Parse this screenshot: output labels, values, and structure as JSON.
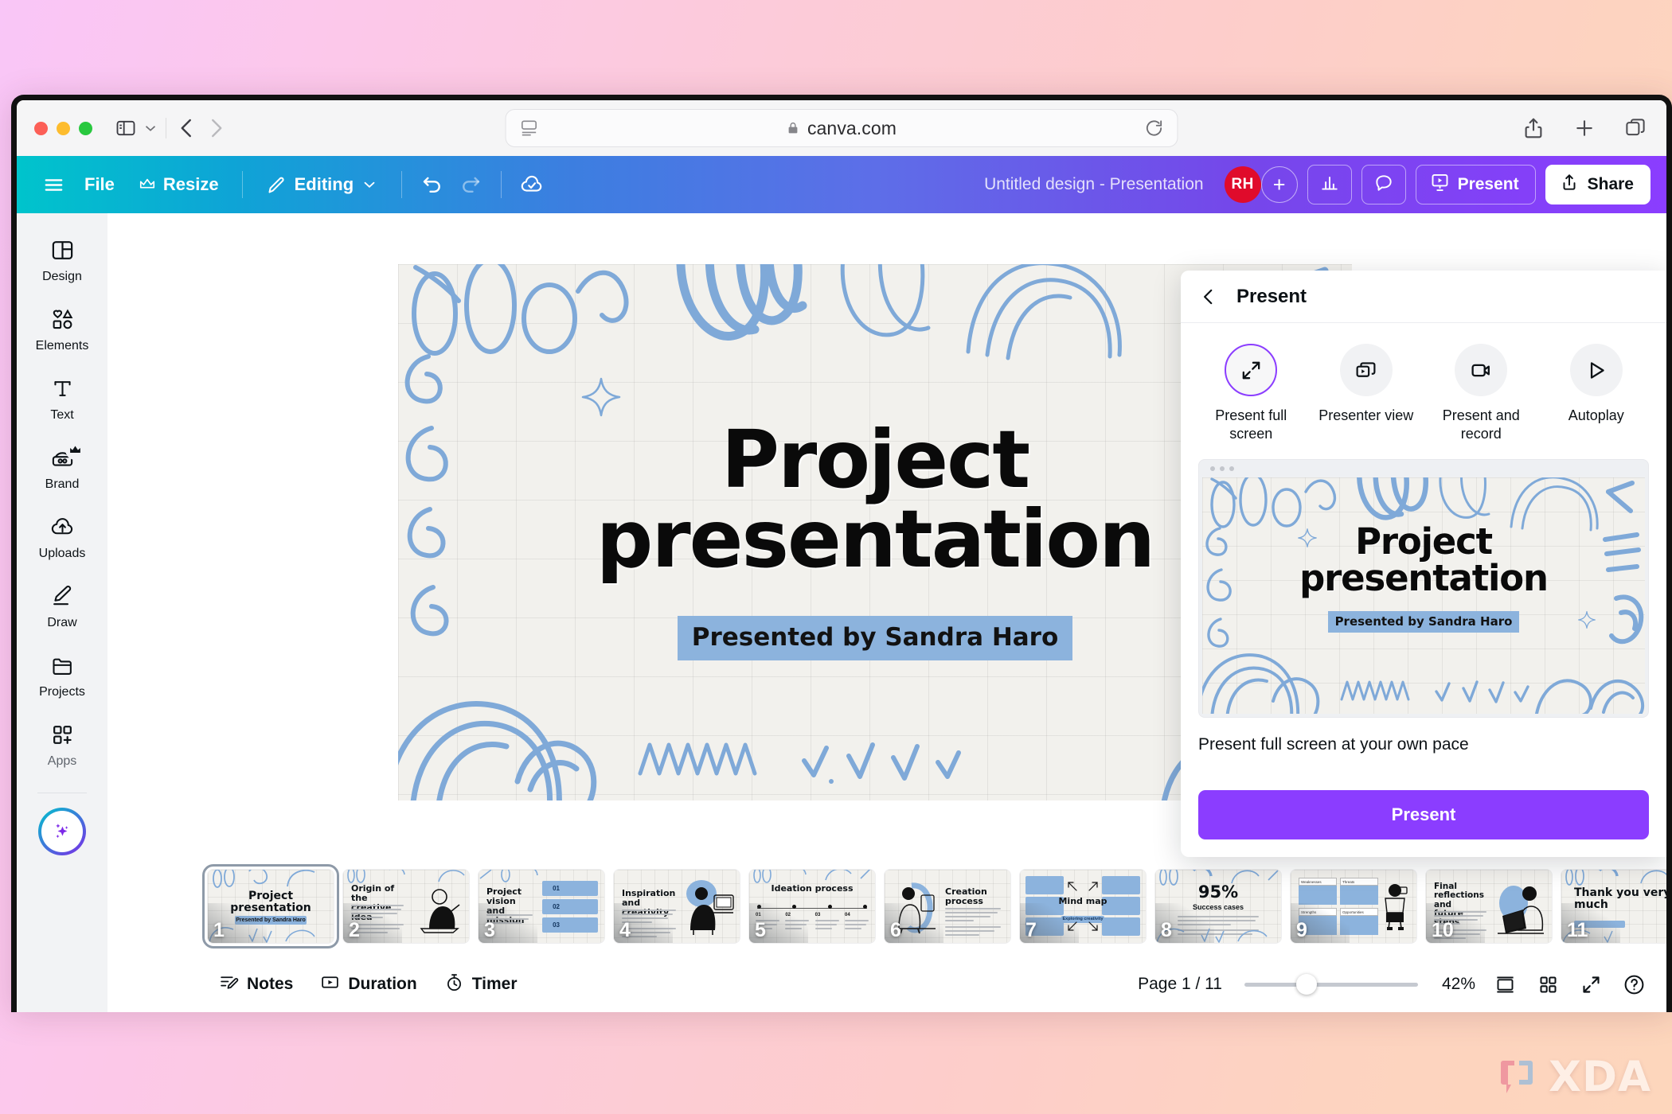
{
  "browser": {
    "url": "canva.com",
    "lock_icon": "lock-icon",
    "reader_icon": "reader-view-icon",
    "reload_icon": "reload-icon",
    "back_icon": "back-chevron-icon",
    "forward_icon": "forward-chevron-icon",
    "sidebar_icon": "sidebar-toggle-icon",
    "share_icon": "share-icon",
    "new_tab_icon": "plus-icon",
    "tabs_icon": "tab-overview-icon"
  },
  "toolbar": {
    "menu_icon": "hamburger-menu-icon",
    "file_label": "File",
    "resize_label": "Resize",
    "resize_icon": "crown-icon",
    "editing_label": "Editing",
    "editing_icon": "pencil-icon",
    "editing_chevron": "chevron-down-icon",
    "undo_icon": "undo-icon",
    "redo_icon": "redo-icon",
    "saved_icon": "cloud-check-icon",
    "doc_title": "Untitled design - Presentation",
    "avatar_initials": "RH",
    "add_collaborator": "+",
    "insights_icon": "bar-chart-icon",
    "comments_icon": "comment-bubble-icon",
    "present_label": "Present",
    "present_icon": "presentation-screen-icon",
    "share_label": "Share",
    "share_icon": "upload-share-icon"
  },
  "sidebar": {
    "items": [
      {
        "label": "Design",
        "icon": "design-layout-icon"
      },
      {
        "label": "Elements",
        "icon": "shapes-icon"
      },
      {
        "label": "Text",
        "icon": "text-t-icon"
      },
      {
        "label": "Brand",
        "icon": "brand-kit-icon",
        "badge": "crown-icon"
      },
      {
        "label": "Uploads",
        "icon": "cloud-upload-icon"
      },
      {
        "label": "Draw",
        "icon": "draw-pen-icon"
      },
      {
        "label": "Projects",
        "icon": "folder-icon"
      },
      {
        "label": "Apps",
        "icon": "apps-grid-icon"
      }
    ],
    "magic_button": "magic-studio-sparkle-icon"
  },
  "canvas": {
    "slide": {
      "title_line1": "Project",
      "title_line2": "presentation",
      "subtitle": "Presented by Sandra Haro"
    }
  },
  "present_panel": {
    "back_icon": "back-chevron-icon",
    "title": "Present",
    "modes": [
      {
        "label": "Present full screen",
        "icon": "expand-arrows-icon",
        "active": true
      },
      {
        "label": "Presenter view",
        "icon": "presenter-windows-icon",
        "active": false
      },
      {
        "label": "Present and record",
        "icon": "video-camera-icon",
        "active": false
      },
      {
        "label": "Autoplay",
        "icon": "play-triangle-icon",
        "active": false
      }
    ],
    "preview": {
      "title_line1": "Project",
      "title_line2": "presentation",
      "subtitle": "Presented by Sandra Haro"
    },
    "description": "Present full screen at your own pace",
    "cta_label": "Present",
    "accent_color": "#8b3dff"
  },
  "thumbnails": [
    {
      "num": "1",
      "kind": "title",
      "title": "Project presentation",
      "subtitle": "Presented by Sandra Haro",
      "selected": true
    },
    {
      "num": "2",
      "kind": "text-img",
      "title": "Origin of the creative idea",
      "selected": false
    },
    {
      "num": "3",
      "kind": "numbered",
      "title": "Project vision and mission",
      "items": [
        "01",
        "02",
        "03"
      ],
      "selected": false
    },
    {
      "num": "4",
      "kind": "text-img",
      "title": "Inspiration and creativity",
      "selected": false
    },
    {
      "num": "5",
      "kind": "timeline",
      "title": "Ideation process",
      "items": [
        "01",
        "02",
        "03",
        "04"
      ],
      "selected": false
    },
    {
      "num": "6",
      "kind": "img-text",
      "title": "Creation process",
      "selected": false
    },
    {
      "num": "7",
      "kind": "mindmap",
      "title": "Mind map",
      "subtitle": "Exploring creativity",
      "selected": false
    },
    {
      "num": "8",
      "kind": "stat",
      "title": "95%",
      "subtitle": "Success cases",
      "selected": false
    },
    {
      "num": "9",
      "kind": "quadrant",
      "items": [
        "Weaknesses",
        "Threats",
        "Strengths",
        "Opportunities"
      ],
      "selected": false
    },
    {
      "num": "10",
      "kind": "text-img",
      "title": "Final reflections and future steps",
      "selected": false
    },
    {
      "num": "11",
      "kind": "thanks",
      "title": "Thank you very much",
      "selected": false
    }
  ],
  "statusbar": {
    "notes_label": "Notes",
    "notes_icon": "notes-pencil-icon",
    "duration_label": "Duration",
    "duration_icon": "duration-play-icon",
    "timer_label": "Timer",
    "timer_icon": "stopwatch-icon",
    "page_indicator": "Page 1 / 11",
    "zoom_level": "42%",
    "view_icon": "single-page-view-icon",
    "grid_icon": "grid-view-icon",
    "fullscreen_icon": "fullscreen-expand-icon",
    "help_icon": "help-question-icon"
  },
  "watermark": {
    "text": "XDA"
  }
}
